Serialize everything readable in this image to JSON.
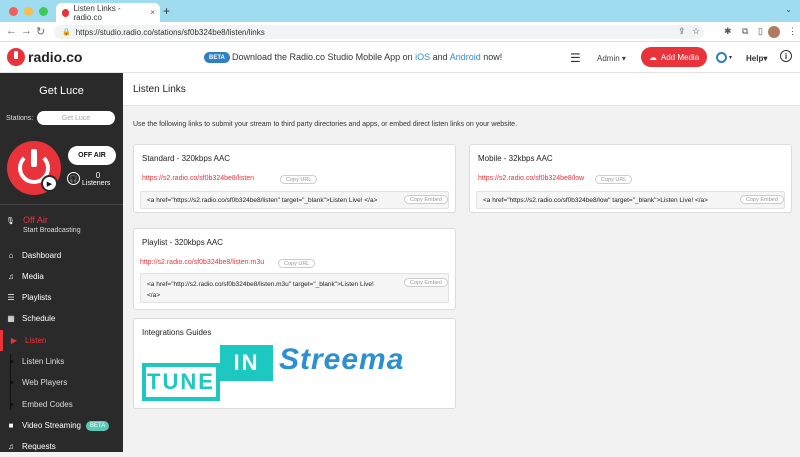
{
  "browser": {
    "tab_title": "Listen Links - radio.co",
    "tab_close": "×",
    "new_tab": "+",
    "tab_chevron": "⌄",
    "url": "https://studio.radio.co/stations/sf0b324be8/listen/links"
  },
  "header": {
    "logo_text": "radio.co",
    "beta_badge": "BETA",
    "promo_text": "Download the Radio.co Studio Mobile App on",
    "promo_ios": "iOS",
    "promo_and": "and",
    "promo_android": "Android",
    "promo_suffix": "now!",
    "admin_label": "Admin",
    "add_media_label": "Add Media",
    "help_label": "Help",
    "info_label": "i"
  },
  "sidebar": {
    "station_name": "Get Luce",
    "stations_label": "Stations:",
    "stations_select": "Get Luce",
    "off_air_button": "OFF AIR",
    "listener_count": "0",
    "listener_label": "Listeners",
    "status_title": "Off Air",
    "status_sub": "Start Broadcasting",
    "nav": {
      "dashboard": "Dashboard",
      "media": "Media",
      "playlists": "Playlists",
      "schedule": "Schedule",
      "listen": "Listen",
      "listen_links": "Listen Links",
      "web_players": "Web Players",
      "embed_codes": "Embed Codes",
      "video_streaming": "Video Streaming",
      "video_beta": "BETA",
      "requests": "Requests"
    }
  },
  "main": {
    "title": "Listen Links",
    "intro": "Use the following links to submit your stream to third party directories and apps, or embed direct listen links on your website.",
    "copy_url_label": "Copy URL",
    "copy_embed_label": "Copy Embed",
    "cards": {
      "standard": {
        "title": "Standard - 320kbps AAC",
        "url": "https://s2.radio.co/sf0b324be8/listen",
        "embed": "<a href=\"https://s2.radio.co/sf0b324be8/listen\" target=\"_blank\">Listen Live! </a>"
      },
      "mobile": {
        "title": "Mobile - 32kbps AAC",
        "url": "https://s2.radio.co/sf0b324be8/low",
        "embed": "<a href=\"https://s2.radio.co/sf0b324be8/low\" target=\"_blank\">Listen Live! </a>"
      },
      "playlist": {
        "title": "Playlist - 320kbps AAC",
        "url": "http://s2.radio.co/sf0b324be8/listen.m3u",
        "embed_line1": "<a href=\"http://s2.radio.co/sf0b324be8/listen.m3u\" target=\"_blank\">Listen Live!",
        "embed_line2": "</a>"
      },
      "integrations": {
        "title": "Integrations Guides",
        "tunein_tune": "TUNE",
        "tunein_in": "IN",
        "streema": "Streema"
      }
    }
  },
  "colors": {
    "brand_red": "#e8333b",
    "sidebar_bg": "#2a2a2a",
    "tunein_teal": "#1cc8c0",
    "streema_blue": "#2b8fd1"
  }
}
